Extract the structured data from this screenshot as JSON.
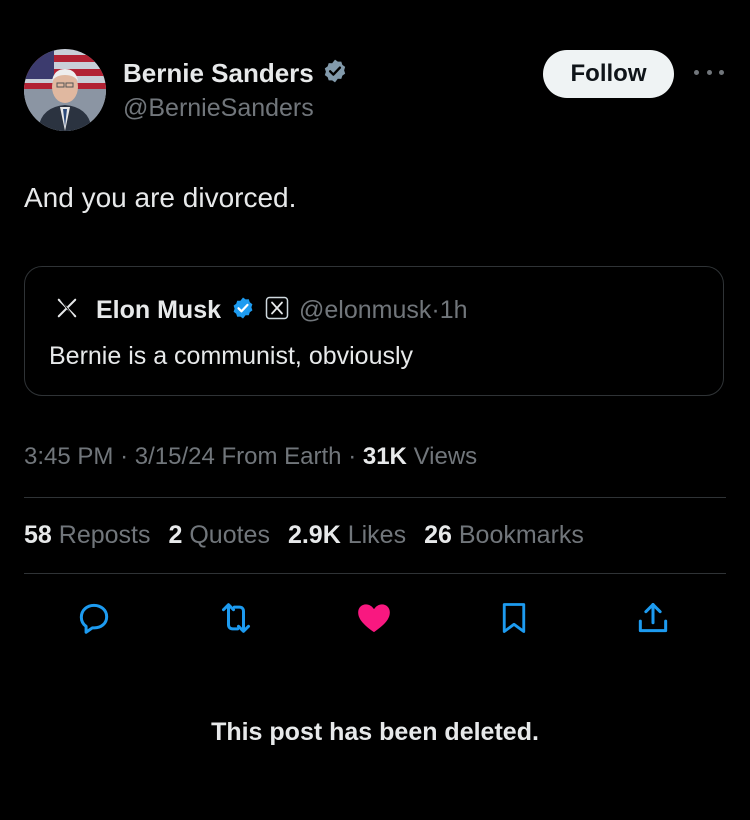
{
  "author": {
    "name": "Bernie Sanders",
    "handle": "@BernieSanders",
    "verified_icon": "verified-badge-icon",
    "verified_color": "#1d9bf0"
  },
  "header": {
    "follow_label": "Follow",
    "more_icon": "more-dots-icon"
  },
  "post": {
    "text": "And you are divorced."
  },
  "quoted_post": {
    "platform_icon": "x-logo-icon",
    "name": "Elon Musk",
    "handle": "@elonmusk",
    "separator": "·",
    "time": "1h",
    "text": "Bernie is a communist, obviously"
  },
  "meta": {
    "time": "3:45 PM",
    "date": "3/15/24",
    "source": "From Earth",
    "views_count": "31K",
    "views_label": "Views",
    "separator": "·"
  },
  "stats": [
    {
      "count": "58",
      "label": "Reposts"
    },
    {
      "count": "2",
      "label": "Quotes"
    },
    {
      "count": "2.9K",
      "label": "Likes"
    },
    {
      "count": "26",
      "label": "Bookmarks"
    }
  ],
  "actions": {
    "reply_icon": "reply-icon",
    "repost_icon": "repost-icon",
    "like_icon": "heart-icon",
    "like_color": "#f91880",
    "bookmark_icon": "bookmark-icon",
    "share_icon": "share-icon"
  },
  "footer": {
    "deleted_notice": "This post has been deleted."
  }
}
